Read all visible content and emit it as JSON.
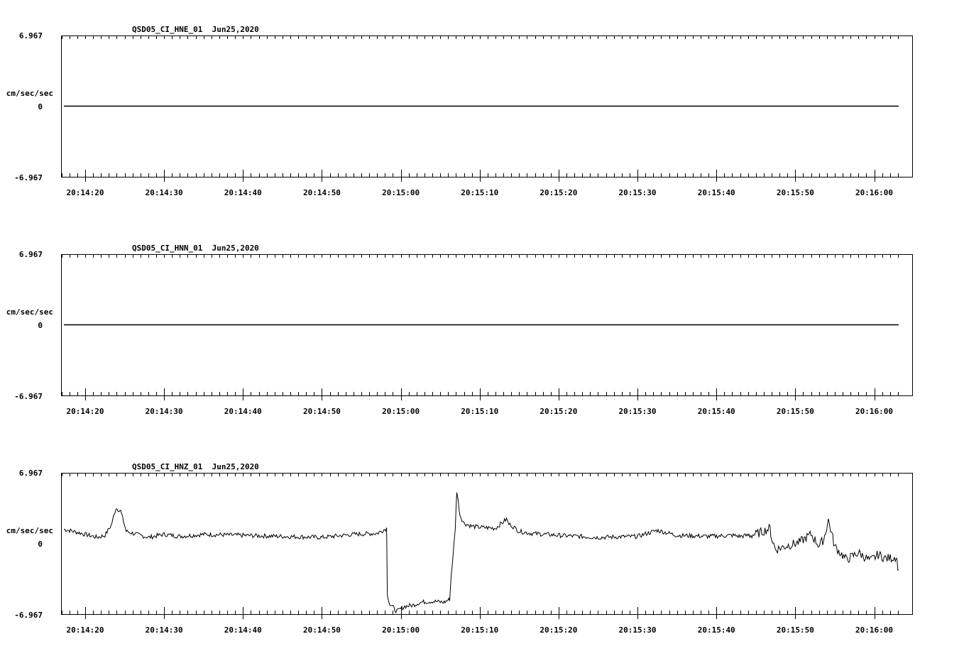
{
  "date": "Jun25,2020",
  "units": "cm/sec/sec",
  "ytick_labels": [
    "6.967",
    "0",
    "-6.967"
  ],
  "time_ticks": [
    "20:14:20",
    "20:14:30",
    "20:14:40",
    "20:14:50",
    "20:15:00",
    "20:15:10",
    "20:15:20",
    "20:15:30",
    "20:15:40",
    "20:15:50",
    "20:16:00"
  ],
  "chart_data": [
    {
      "type": "line",
      "title": "QSD05_CI_HNE_01  Jun25,2020",
      "ylabel": "cm/sec/sec",
      "ylim": [
        -6.967,
        6.967
      ],
      "xlim_seconds_after_20:14:00": [
        16.1,
        123.4
      ],
      "x": [
        17.3,
        123.1
      ],
      "y": [
        0,
        0
      ]
    },
    {
      "type": "line",
      "title": "QSD05_CI_HNN_01  Jun25,2020",
      "ylabel": "cm/sec/sec",
      "ylim": [
        -6.967,
        6.967
      ],
      "xlim_seconds_after_20:14:00": [
        16.1,
        123.4
      ],
      "x": [
        17.3,
        123.1
      ],
      "y": [
        0,
        0
      ]
    },
    {
      "type": "line",
      "title": "QSD05_CI_HNZ_01  Jun25,2020",
      "ylabel": "cm/sec/sec",
      "ylim": [
        -6.967,
        6.967
      ],
      "xlim_seconds_after_20:14:00": [
        16.1,
        123.4
      ],
      "x": [
        17.3,
        18.5,
        20.0,
        21.5,
        22.5,
        23.3,
        23.9,
        24.5,
        25.2,
        26.5,
        28.0,
        30.0,
        32.0,
        35.0,
        40.0,
        45.0,
        50.0,
        54.0,
        57.0,
        58.2,
        58.3,
        58.6,
        59.0,
        59.5,
        60.5,
        61.5,
        62.5,
        64.0,
        65.5,
        66.2,
        66.4,
        66.6,
        66.9,
        67.1,
        67.3,
        67.5,
        68.0,
        69.0,
        70.0,
        72.0,
        73.4,
        73.7,
        74.0,
        75.0,
        76.5,
        80.0,
        85.0,
        90.0,
        92.5,
        95.0,
        99.0,
        102.0,
        103.0,
        105.0,
        106.8,
        107.0,
        107.5,
        109.0,
        110.5,
        112.0,
        113.0,
        113.6,
        114.2,
        115.0,
        116.5,
        118.0,
        119.5,
        120.5,
        121.5,
        122.3,
        122.8,
        123.0,
        123.1
      ],
      "y": [
        1.4,
        1.2,
        0.9,
        0.6,
        0.8,
        1.8,
        3.5,
        3.2,
        1.2,
        0.9,
        0.6,
        0.9,
        0.7,
        0.9,
        0.8,
        0.7,
        0.6,
        0.9,
        1.0,
        1.5,
        -5.0,
        -6.0,
        -6.3,
        -6.7,
        -6.2,
        -6.1,
        -5.8,
        -5.7,
        -5.8,
        -5.5,
        -3.0,
        -1.5,
        1.5,
        5.2,
        4.0,
        2.8,
        2.0,
        1.7,
        1.6,
        1.5,
        2.4,
        1.9,
        1.8,
        1.2,
        1.0,
        0.8,
        0.6,
        0.7,
        1.3,
        0.8,
        0.7,
        0.8,
        0.7,
        0.9,
        1.5,
        0.5,
        -0.6,
        -0.2,
        0.1,
        0.9,
        -0.2,
        0.4,
        2.3,
        -0.3,
        -1.6,
        -0.9,
        -1.7,
        -1.1,
        -1.5,
        -1.4,
        -1.3,
        -2.2,
        -2.6
      ]
    }
  ]
}
